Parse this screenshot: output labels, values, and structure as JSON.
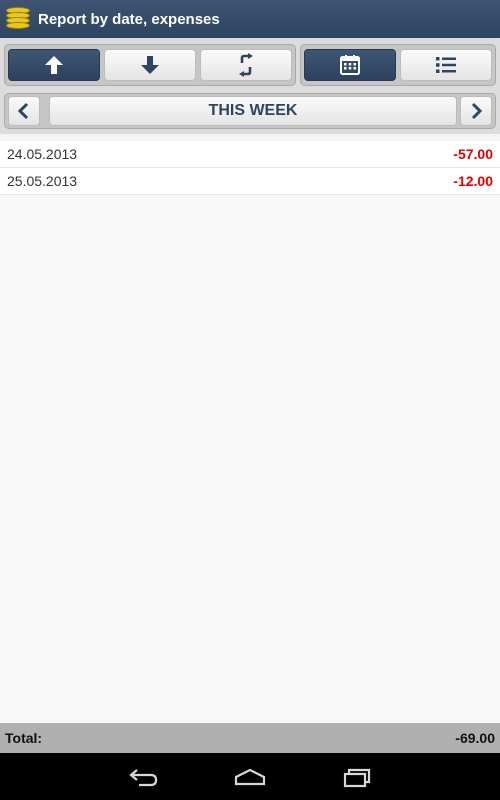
{
  "titlebar": {
    "title": "Report by date, expenses",
    "icon": "coins-stack-icon"
  },
  "toolbar": {
    "buttons": [
      {
        "name": "sort-ascending-button",
        "icon": "arrow-up-icon",
        "active": true
      },
      {
        "name": "sort-descending-button",
        "icon": "arrow-down-icon",
        "active": false
      },
      {
        "name": "refresh-button",
        "icon": "refresh-icon",
        "active": false
      },
      {
        "name": "calendar-view-button",
        "icon": "calendar-icon",
        "active": true
      },
      {
        "name": "list-view-button",
        "icon": "list-icon",
        "active": false
      }
    ]
  },
  "period": {
    "label": "THIS WEEK"
  },
  "rows": [
    {
      "date": "24.05.2013",
      "amount": "-57.00"
    },
    {
      "date": "25.05.2013",
      "amount": "-12.00"
    }
  ],
  "total": {
    "label": "Total:",
    "value": "-69.00"
  },
  "colors": {
    "header": "#2f4461",
    "negative": "#e00000",
    "accent_coin": "#e8c820"
  }
}
